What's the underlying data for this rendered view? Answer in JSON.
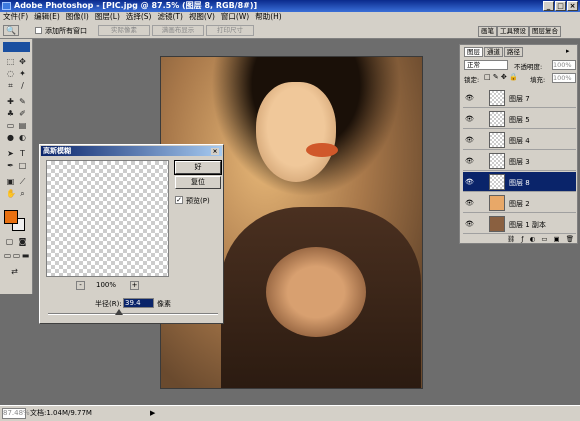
{
  "title": "Adobe Photoshop - [PIC.jpg @ 87.5% (图层 8, RGB/8#)]",
  "menu": [
    "文件(F)",
    "编辑(E)",
    "图像(I)",
    "图层(L)",
    "选择(S)",
    "滤镜(T)",
    "视图(V)",
    "窗口(W)",
    "帮助(H)"
  ],
  "options": {
    "add_all_windows": "添加所有窗口",
    "actual_pixels": "实际像素",
    "fit_on_screen": "满画布显示",
    "print_size": "打印尺寸"
  },
  "tool_tabs": [
    "画笔",
    "工具预设",
    "图层复合"
  ],
  "dialog": {
    "title": "高斯模糊",
    "ok": "好",
    "reset": "复位",
    "preview_label": "预览(P)",
    "zoom": "100%",
    "zoom_minus": "-",
    "zoom_plus": "+",
    "radius_label": "半径(R):",
    "radius_value": "39.4",
    "radius_unit": "像素",
    "close": "×"
  },
  "layers_panel": {
    "tabs": [
      "图层",
      "通道",
      "路径"
    ],
    "blend_mode": "正常",
    "opacity_label": "不透明度:",
    "opacity_value": "100%",
    "lock_label": "锁定:",
    "fill_label": "填充:",
    "fill_value": "100%",
    "layers": [
      {
        "name": "图层 7"
      },
      {
        "name": "图层 5"
      },
      {
        "name": "图层 4"
      },
      {
        "name": "图层 3"
      },
      {
        "name": "图层 8",
        "selected": true
      },
      {
        "name": "图层 2"
      },
      {
        "name": "图层 1 副本"
      }
    ]
  },
  "status": {
    "zoom": "87.48%",
    "doc": "文档:1.04M/9.77M"
  },
  "colors": {
    "foreground": "#e87010",
    "background": "#f0f0f0",
    "selected_layer": "#0a246a"
  }
}
